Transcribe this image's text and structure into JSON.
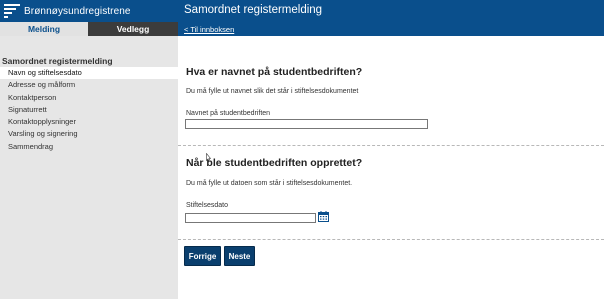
{
  "header": {
    "logo_text": "Brønnøysundregistrene",
    "title": "Samordnet registermelding",
    "back_link": "< Til innboksen"
  },
  "tabs": [
    {
      "label": "Melding",
      "active": true
    },
    {
      "label": "Vedlegg",
      "active": false
    }
  ],
  "sidebar": {
    "heading": "Samordnet registermelding",
    "items": [
      {
        "label": "Navn og stiftelsesdato",
        "active": true
      },
      {
        "label": "Adresse og målform"
      },
      {
        "label": "Kontaktperson"
      },
      {
        "label": "Signaturrett"
      },
      {
        "label": "Kontaktopplysninger"
      },
      {
        "label": "Varsling og signering"
      },
      {
        "label": "Sammendrag"
      }
    ]
  },
  "section_name": {
    "title": "Hva er navnet på studentbedriften?",
    "help": "Du må fylle ut navnet slik det står i stiftelsesdokumentet",
    "label": "Navnet på studentbedriften",
    "value": ""
  },
  "section_date": {
    "title": "Når ble studentbedriften opprettet?",
    "help": "Du må fylle ut datoen som står i stiftelsesdokumentet.",
    "label": "Stiftelsesdato",
    "value": "",
    "icon": "calendar-icon"
  },
  "buttons": {
    "prev": "Forrige",
    "next": "Neste"
  },
  "colors": {
    "brand_blue": "#0a4f8c",
    "button_blue": "#0a3f6e",
    "sidebar_bg": "#e6e6e6"
  }
}
